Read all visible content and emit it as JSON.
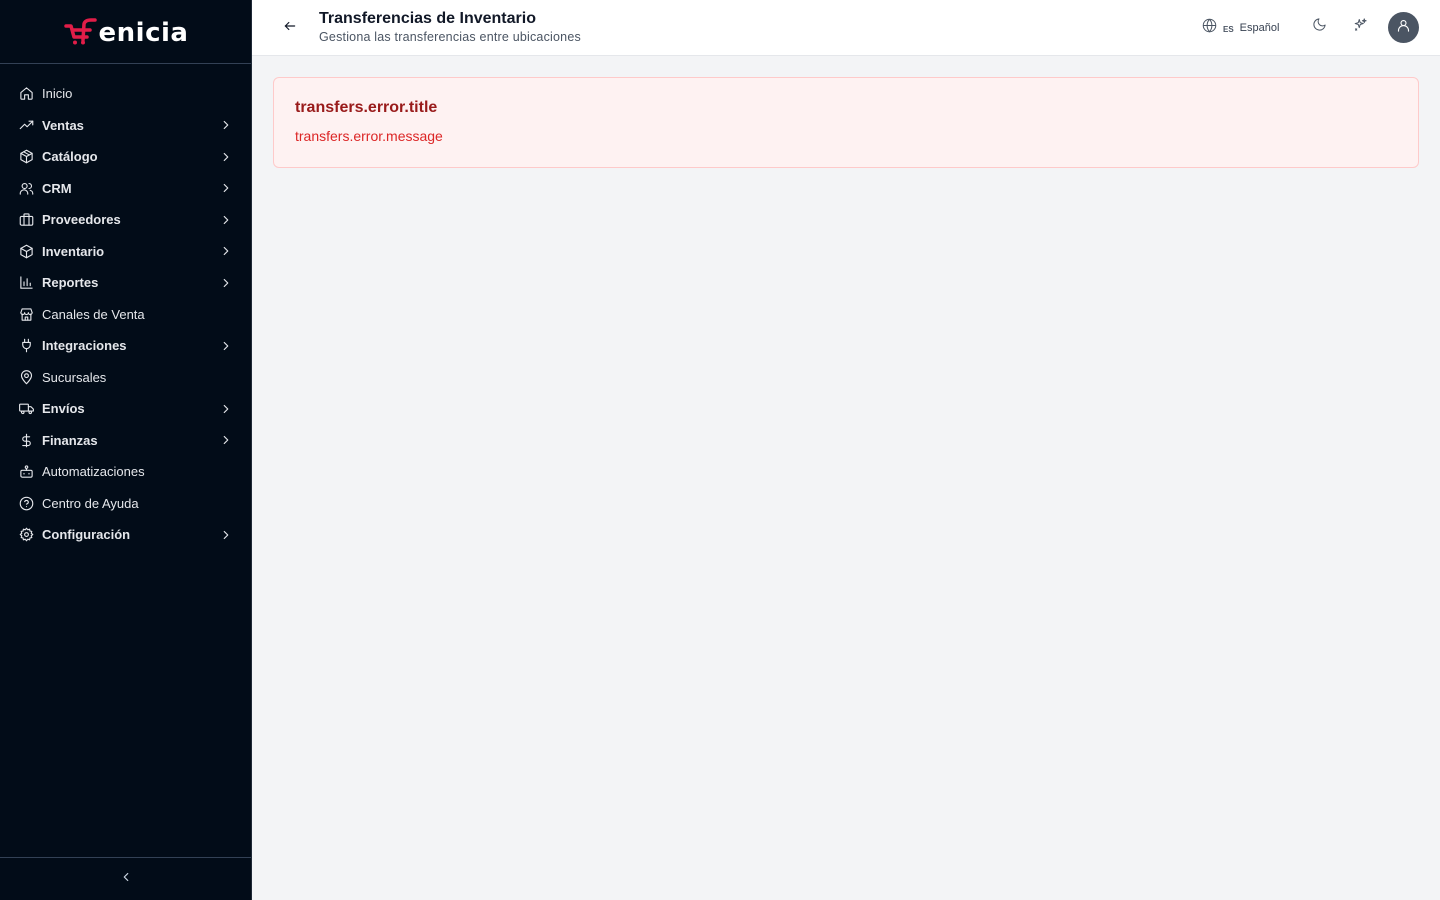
{
  "brand": {
    "name": "enicia",
    "tagline": "",
    "accent": "#e11d48"
  },
  "sidebar": {
    "items": [
      {
        "label": "Inicio",
        "icon": "home-icon",
        "bold": false,
        "expandable": false
      },
      {
        "label": "Ventas",
        "icon": "trending-up-icon",
        "bold": true,
        "expandable": true
      },
      {
        "label": "Catálogo",
        "icon": "package-icon",
        "bold": true,
        "expandable": true
      },
      {
        "label": "CRM",
        "icon": "users-icon",
        "bold": true,
        "expandable": true
      },
      {
        "label": "Proveedores",
        "icon": "briefcase-icon",
        "bold": true,
        "expandable": true
      },
      {
        "label": "Inventario",
        "icon": "box-icon",
        "bold": true,
        "expandable": true
      },
      {
        "label": "Reportes",
        "icon": "bar-chart-icon",
        "bold": true,
        "expandable": true
      },
      {
        "label": "Canales de Venta",
        "icon": "store-icon",
        "bold": false,
        "expandable": false
      },
      {
        "label": "Integraciones",
        "icon": "plug-icon",
        "bold": true,
        "expandable": true
      },
      {
        "label": "Sucursales",
        "icon": "map-pin-icon",
        "bold": false,
        "expandable": false
      },
      {
        "label": "Envíos",
        "icon": "truck-icon",
        "bold": true,
        "expandable": true
      },
      {
        "label": "Finanzas",
        "icon": "dollar-icon",
        "bold": true,
        "expandable": true
      },
      {
        "label": "Automatizaciones",
        "icon": "bot-icon",
        "bold": false,
        "expandable": false
      },
      {
        "label": "Centro de Ayuda",
        "icon": "help-circle-icon",
        "bold": false,
        "expandable": false
      },
      {
        "label": "Configuración",
        "icon": "settings-icon",
        "bold": true,
        "expandable": true
      }
    ],
    "collapse_icon": "chevron-left-icon"
  },
  "header": {
    "title": "Transferencias de Inventario",
    "subtitle": "Gestiona las transferencias entre ubicaciones",
    "language_code": "ES",
    "language_name": "Español"
  },
  "error": {
    "title": "transfers.error.title",
    "message": "transfers.error.message"
  }
}
